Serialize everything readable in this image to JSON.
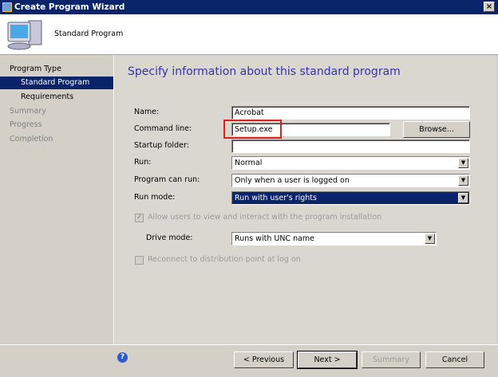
{
  "window": {
    "title": "Create Program Wizard",
    "close": "×"
  },
  "header": {
    "title": "Standard Program"
  },
  "sidebar": {
    "items": [
      {
        "label": "Program Type"
      },
      {
        "label": "Standard Program"
      },
      {
        "label": "Requirements"
      },
      {
        "label": "Summary"
      },
      {
        "label": "Progress"
      },
      {
        "label": "Completion"
      }
    ]
  },
  "main": {
    "heading": "Specify information about this standard program",
    "name_label": "Name:",
    "name_value": "Acrobat",
    "cmd_label": "Command line:",
    "cmd_value": "Setup.exe",
    "browse": "Browse...",
    "startup_label": "Startup folder:",
    "startup_value": "",
    "run_label": "Run:",
    "run_value": "Normal",
    "canrun_label": "Program can run:",
    "canrun_value": "Only when a user is logged on",
    "runmode_label": "Run mode:",
    "runmode_value": "Run with user's rights",
    "allow_label": "Allow users to view and interact with the program installation",
    "drive_label": "Drive mode:",
    "drive_value": "Runs with UNC name",
    "reconnect_label": "Reconnect to distribution point at log on"
  },
  "footer": {
    "previous": "< Previous",
    "next": "Next >",
    "summary": "Summary",
    "cancel": "Cancel",
    "help": "?"
  },
  "colors": {
    "highlight": "#0a246a",
    "heading": "#3333aa",
    "annotation": "#e02020"
  }
}
